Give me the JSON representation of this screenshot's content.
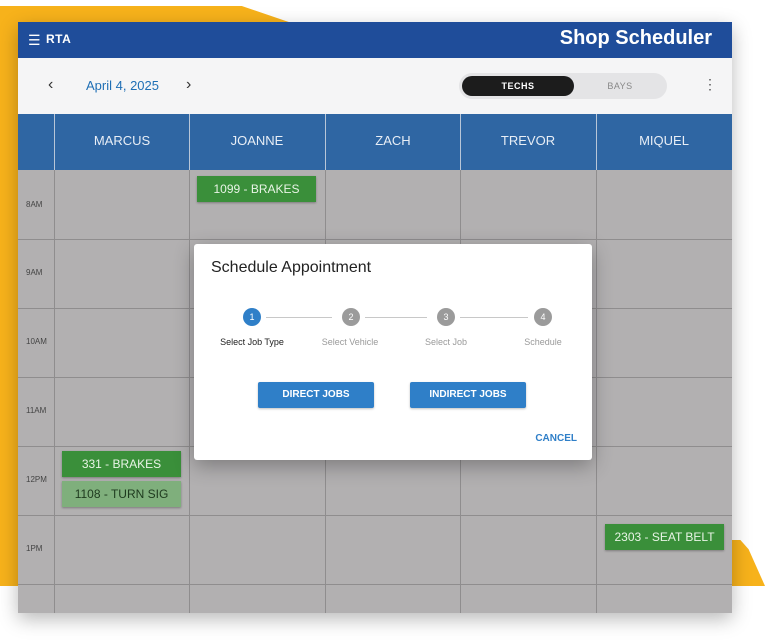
{
  "app": {
    "brand": "RTA",
    "title": "Shop Scheduler"
  },
  "toolbar": {
    "date": "April 4, 2025",
    "view_toggle": {
      "active": "TECHS",
      "inactive": "BAYS"
    }
  },
  "columns": [
    "MARCUS",
    "JOANNE",
    "ZACH",
    "TREVOR",
    "MIQUEL"
  ],
  "times": [
    "8AM",
    "9AM",
    "10AM",
    "11AM",
    "12PM",
    "1PM"
  ],
  "appointments": [
    {
      "label": "1099 - BRAKES",
      "tech": "JOANNE",
      "time": "8AM"
    },
    {
      "label": "331 - BRAKES",
      "tech": "MARCUS",
      "time": "12PM"
    },
    {
      "label": "1108 - TURN SIG",
      "tech": "MARCUS",
      "time": "12PM"
    },
    {
      "label": "2303 - SEAT BELT",
      "tech": "MIQUEL",
      "time": "1PM"
    }
  ],
  "dialog": {
    "title": "Schedule Appointment",
    "steps": [
      {
        "number": "1",
        "label": "Select Job Type"
      },
      {
        "number": "2",
        "label": "Select Vehicle"
      },
      {
        "number": "3",
        "label": "Select Job"
      },
      {
        "number": "4",
        "label": "Schedule"
      }
    ],
    "direct_button": "DIRECT JOBS",
    "indirect_button": "INDIRECT JOBS",
    "cancel": "CANCEL"
  },
  "colors": {
    "titlebar": "#1f4d9a",
    "header": "#2f66a3",
    "accent": "#2f7fc8",
    "appointment": "#3a8f3a",
    "backdrop": "#F7B21B"
  },
  "icons": {
    "menu": "hamburger-icon",
    "prev": "chevron-left-icon",
    "next": "chevron-right-icon",
    "more": "more-vertical-icon"
  }
}
